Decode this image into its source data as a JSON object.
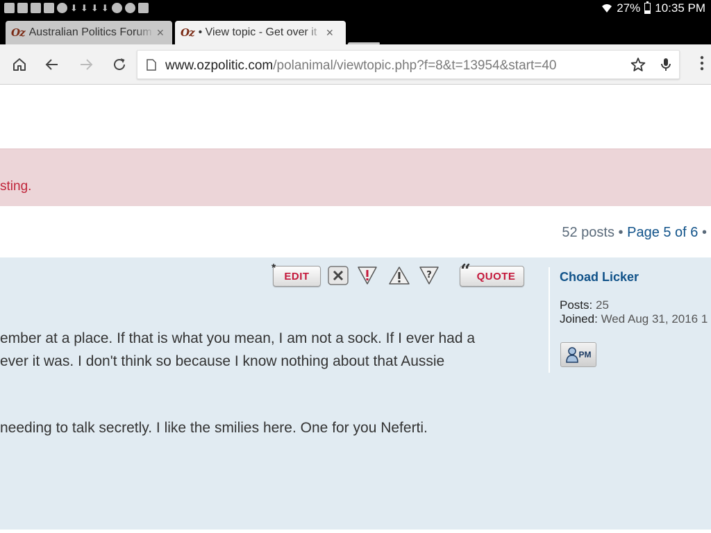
{
  "status_bar": {
    "battery": "27%",
    "time": "10:35 PM",
    "battery_level": 0.27
  },
  "tabs": [
    {
      "favicon_text": "Oz",
      "title": "Australian Politics Forum",
      "close": "×"
    },
    {
      "favicon_text": "Oz",
      "title": "• View topic - Get over it",
      "close": "×"
    }
  ],
  "toolbar": {
    "url_host": "www.ozpolitic.com",
    "url_path": "/polanimal/viewtopic.php?f=8&t=13954&start=40"
  },
  "page": {
    "notice": "sting.",
    "pagination": {
      "count": "52 posts",
      "separator": "•",
      "page_label": "Page 5 of 6",
      "trailing": "•"
    }
  },
  "post": {
    "buttons": {
      "edit": "EDIT",
      "quote": "QUOTE"
    },
    "lines": [
      "ember at a place. If that is what you mean, I am not a sock. If I ever had a",
      "ever it was. I don't think so because I know nothing about that Aussie",
      "needing to talk secretly. I like the smilies here. One for you Neferti."
    ],
    "author": {
      "name": "Choad Licker",
      "posts_label": "Posts:",
      "posts_value": "25",
      "joined_label": "Joined:",
      "joined_value": "Wed Aug 31, 2016 1"
    },
    "pm_label": "PM"
  },
  "colors": {
    "link": "#105289",
    "notice_bg": "#ecd5d8",
    "notice_text": "#c0253a",
    "post_bg": "#e1ebf2",
    "button_red": "#c4173a"
  }
}
